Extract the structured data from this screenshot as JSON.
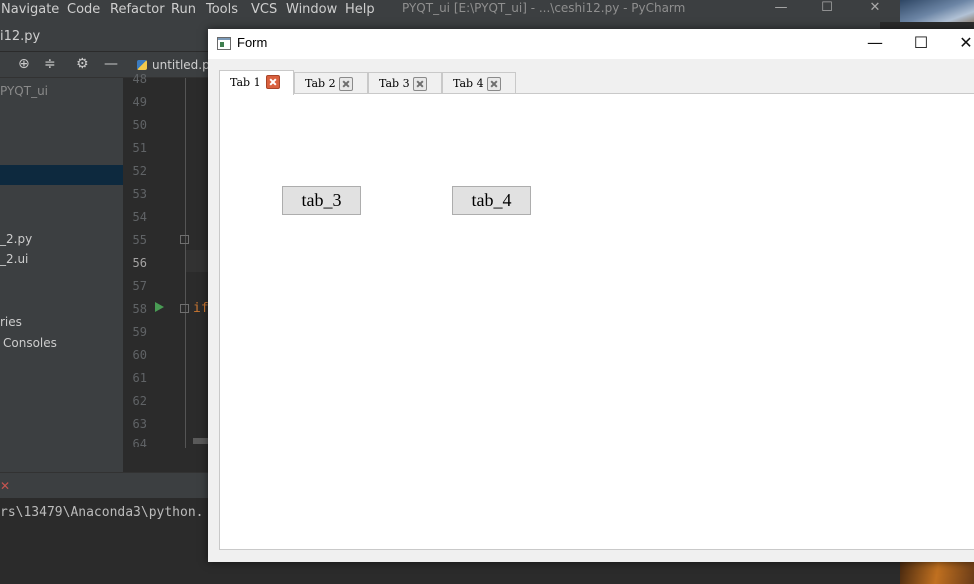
{
  "ide": {
    "menu": [
      "Navigate",
      "Code",
      "Refactor",
      "Run",
      "Tools",
      "VCS",
      "Window",
      "Help"
    ],
    "window_title": "PYQT_ui [E:\\PYQT_ui] - ...\\ceshi12.py - PyCharm",
    "open_file": "i12.py",
    "editor_tab": "untitled.py",
    "project": {
      "root": "PYQT_ui",
      "items": [
        "_2.py",
        "_2.ui",
        "ries",
        "Consoles"
      ]
    },
    "line_numbers": [
      "48",
      "49",
      "50",
      "51",
      "52",
      "53",
      "54",
      "55",
      "56",
      "57",
      "58",
      "59",
      "60",
      "61",
      "62",
      "63",
      "64"
    ],
    "current_line": "56",
    "code_keyword": "if",
    "console_line": "rs\\13479\\Anaconda3\\python."
  },
  "form": {
    "title": "Form",
    "controls": {
      "minimize": "—",
      "maximize": "☐",
      "close": "✕"
    },
    "tabs": [
      {
        "label": "Tab 1",
        "active": true
      },
      {
        "label": "Tab 2",
        "active": false
      },
      {
        "label": "Tab 3",
        "active": false
      },
      {
        "label": "Tab 4",
        "active": false
      }
    ],
    "buttons": [
      "tab_3",
      "tab_4"
    ]
  }
}
